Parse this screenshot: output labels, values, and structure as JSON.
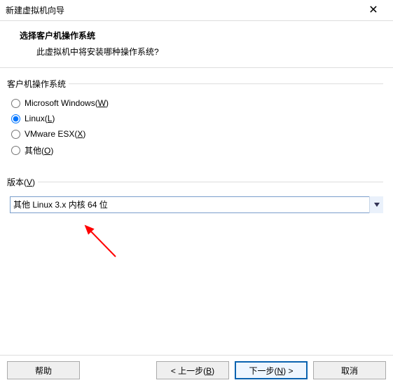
{
  "window": {
    "title": "新建虚拟机向导"
  },
  "header": {
    "title": "选择客户机操作系统",
    "subtitle": "此虚拟机中将安装哪种操作系统?"
  },
  "os_group": {
    "legend": "客户机操作系统",
    "options": [
      {
        "label_pre": "Microsoft Windows(",
        "accel": "W",
        "label_post": ")"
      },
      {
        "label_pre": "Linux(",
        "accel": "L",
        "label_post": ")"
      },
      {
        "label_pre": "VMware ESX(",
        "accel": "X",
        "label_post": ")"
      },
      {
        "label_pre": "其他(",
        "accel": "O",
        "label_post": ")"
      }
    ],
    "selected_index": 1
  },
  "version_group": {
    "legend_pre": "版本(",
    "legend_accel": "V",
    "legend_post": ")",
    "selected": "其他 Linux 3.x 内核 64 位"
  },
  "buttons": {
    "help": "帮助",
    "back_pre": "< 上一步(",
    "back_accel": "B",
    "back_post": ")",
    "next_pre": "下一步(",
    "next_accel": "N",
    "next_post": ") >",
    "cancel": "取消"
  }
}
